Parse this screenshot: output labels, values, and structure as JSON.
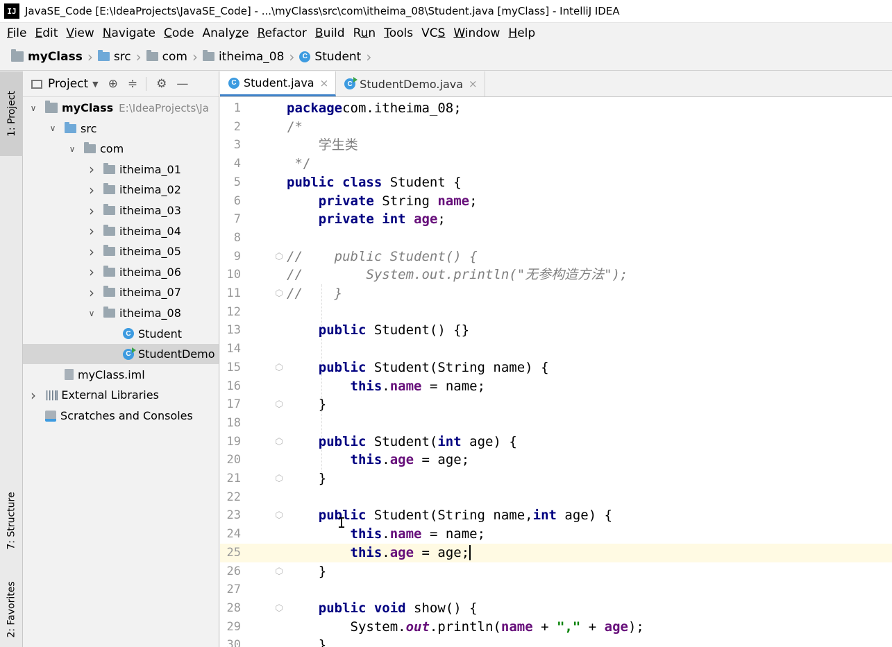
{
  "window": {
    "title": "JavaSE_Code [E:\\IdeaProjects\\JavaSE_Code] - ...\\myClass\\src\\com\\itheima_08\\Student.java [myClass] - IntelliJ IDEA"
  },
  "menu": [
    {
      "underline": "F",
      "rest": "ile"
    },
    {
      "underline": "E",
      "rest": "dit"
    },
    {
      "underline": "V",
      "rest": "iew"
    },
    {
      "underline": "N",
      "rest": "avigate"
    },
    {
      "underline": "C",
      "rest": "ode"
    },
    {
      "pre": "Analy",
      "underline": "z",
      "rest": "e"
    },
    {
      "underline": "R",
      "rest": "efactor"
    },
    {
      "underline": "B",
      "rest": "uild"
    },
    {
      "pre": "R",
      "underline": "u",
      "rest": "n"
    },
    {
      "underline": "T",
      "rest": "ools"
    },
    {
      "pre": "VC",
      "underline": "S",
      "rest": ""
    },
    {
      "underline": "W",
      "rest": "indow"
    },
    {
      "underline": "H",
      "rest": "elp"
    }
  ],
  "breadcrumb": [
    {
      "label": "myClass",
      "icon": "project-folder-icon",
      "bold": true
    },
    {
      "label": "src",
      "icon": "source-folder-icon"
    },
    {
      "label": "com",
      "icon": "package-icon"
    },
    {
      "label": "itheima_08",
      "icon": "package-icon"
    },
    {
      "label": "Student",
      "icon": "class-icon"
    }
  ],
  "sidebar": {
    "tabs": [
      {
        "label": "1: Project",
        "active": true
      },
      {
        "label": "7: Structure"
      },
      {
        "label": "2: Favorites"
      }
    ]
  },
  "project_panel": {
    "header": "Project",
    "tree": [
      {
        "label": "myClass",
        "hint": "E:\\IdeaProjects\\Ja",
        "icon": "project-folder-icon",
        "arrow": "v",
        "bold": true
      },
      {
        "label": "src",
        "icon": "source-folder-icon",
        "arrow": "v"
      },
      {
        "label": "com",
        "icon": "package-icon",
        "arrow": "v"
      },
      {
        "label": "itheima_01",
        "icon": "package-icon",
        "arrow": ">"
      },
      {
        "label": "itheima_02",
        "icon": "package-icon",
        "arrow": ">"
      },
      {
        "label": "itheima_03",
        "icon": "package-icon",
        "arrow": ">"
      },
      {
        "label": "itheima_04",
        "icon": "package-icon",
        "arrow": ">"
      },
      {
        "label": "itheima_05",
        "icon": "package-icon",
        "arrow": ">"
      },
      {
        "label": "itheima_06",
        "icon": "package-icon",
        "arrow": ">"
      },
      {
        "label": "itheima_07",
        "icon": "package-icon",
        "arrow": ">"
      },
      {
        "label": "itheima_08",
        "icon": "package-icon",
        "arrow": "v"
      },
      {
        "label": "Student",
        "icon": "class-icon",
        "arrow": ""
      },
      {
        "label": "StudentDemo",
        "icon": "runnable-class-icon",
        "arrow": "",
        "selected": true
      },
      {
        "label": "myClass.iml",
        "icon": "iml-file-icon",
        "arrow": ""
      },
      {
        "label": "External Libraries",
        "icon": "libraries-icon",
        "arrow": ">"
      },
      {
        "label": "Scratches and Consoles",
        "icon": "scratches-icon",
        "arrow": ""
      }
    ]
  },
  "editor": {
    "tabs": [
      {
        "label": "Student.java",
        "active": true,
        "icon": "class-icon"
      },
      {
        "label": "StudentDemo.java",
        "active": false,
        "icon": "runnable-class-icon"
      }
    ],
    "close_glyph": "×",
    "current_line": 25,
    "lines": [
      {
        "n": "1",
        "s": [
          [
            "kw",
            "package"
          ],
          [
            "",
            "com.itheima_08;"
          ]
        ]
      },
      {
        "n": "2",
        "s": [
          [
            "dcmt",
            "/*"
          ]
        ]
      },
      {
        "n": "3",
        "s": [
          [
            "dcmt",
            "    学生类"
          ]
        ]
      },
      {
        "n": "4",
        "s": [
          [
            "dcmt",
            " */"
          ]
        ]
      },
      {
        "n": "5",
        "s": [
          [
            "kw",
            "public class"
          ],
          [
            "",
            " Student {"
          ]
        ]
      },
      {
        "n": "6",
        "s": [
          [
            "",
            "    "
          ],
          [
            "kw",
            "private"
          ],
          [
            "",
            " String "
          ],
          [
            "fld",
            "name"
          ],
          [
            "",
            ";"
          ]
        ]
      },
      {
        "n": "7",
        "s": [
          [
            "",
            "    "
          ],
          [
            "kw",
            "private int"
          ],
          [
            "",
            " "
          ],
          [
            "fld",
            "age"
          ],
          [
            "",
            ";"
          ]
        ]
      },
      {
        "n": "8",
        "s": []
      },
      {
        "n": "9",
        "s": [
          [
            "cmt",
            "//    public Student() {"
          ]
        ],
        "fold": true
      },
      {
        "n": "10",
        "s": [
          [
            "cmt",
            "//        System.out.println(\"无参构造方法\");"
          ]
        ]
      },
      {
        "n": "11",
        "s": [
          [
            "cmt",
            "//    }"
          ]
        ],
        "fold": true
      },
      {
        "n": "12",
        "s": []
      },
      {
        "n": "13",
        "s": [
          [
            "",
            "    "
          ],
          [
            "kw",
            "public"
          ],
          [
            "",
            " Student() {}"
          ]
        ]
      },
      {
        "n": "14",
        "s": []
      },
      {
        "n": "15",
        "s": [
          [
            "",
            "    "
          ],
          [
            "kw",
            "public"
          ],
          [
            "",
            " Student(String name) {"
          ]
        ],
        "fold": true
      },
      {
        "n": "16",
        "s": [
          [
            "",
            "        "
          ],
          [
            "kw",
            "this"
          ],
          [
            "",
            "."
          ],
          [
            "fld",
            "name"
          ],
          [
            "",
            " = name;"
          ]
        ]
      },
      {
        "n": "17",
        "s": [
          [
            "",
            "    }"
          ]
        ],
        "fold": true
      },
      {
        "n": "18",
        "s": []
      },
      {
        "n": "19",
        "s": [
          [
            "",
            "    "
          ],
          [
            "kw",
            "public"
          ],
          [
            "",
            " Student("
          ],
          [
            "kw",
            "int"
          ],
          [
            "",
            " age) {"
          ]
        ],
        "fold": true
      },
      {
        "n": "20",
        "s": [
          [
            "",
            "        "
          ],
          [
            "kw",
            "this"
          ],
          [
            "",
            "."
          ],
          [
            "fld",
            "age"
          ],
          [
            "",
            " = age;"
          ]
        ]
      },
      {
        "n": "21",
        "s": [
          [
            "",
            "    }"
          ]
        ],
        "fold": true
      },
      {
        "n": "22",
        "s": []
      },
      {
        "n": "23",
        "s": [
          [
            "",
            "    "
          ],
          [
            "kw",
            "public"
          ],
          [
            "",
            " Student(String name,"
          ],
          [
            "kw",
            "int"
          ],
          [
            "",
            " age) {"
          ]
        ],
        "fold": true
      },
      {
        "n": "24",
        "s": [
          [
            "",
            "        "
          ],
          [
            "kw",
            "this"
          ],
          [
            "",
            "."
          ],
          [
            "fld",
            "name"
          ],
          [
            "",
            " = name;"
          ]
        ]
      },
      {
        "n": "25",
        "s": [
          [
            "",
            "        "
          ],
          [
            "kw",
            "this"
          ],
          [
            "",
            "."
          ],
          [
            "fld",
            "age"
          ],
          [
            "",
            " = age;"
          ]
        ],
        "caret": true
      },
      {
        "n": "26",
        "s": [
          [
            "",
            "    }"
          ]
        ],
        "fold": true
      },
      {
        "n": "27",
        "s": []
      },
      {
        "n": "28",
        "s": [
          [
            "",
            "    "
          ],
          [
            "kw",
            "public void"
          ],
          [
            "",
            " show() {"
          ]
        ],
        "fold": true
      },
      {
        "n": "29",
        "s": [
          [
            "",
            "        System."
          ],
          [
            "stat",
            "out"
          ],
          [
            "",
            ".println("
          ],
          [
            "fld",
            "name"
          ],
          [
            "",
            " + "
          ],
          [
            "str",
            "\",\""
          ],
          [
            "",
            " + "
          ],
          [
            "fld",
            "age"
          ],
          [
            "",
            ");"
          ]
        ]
      },
      {
        "n": "30",
        "s": [
          [
            "",
            "    }"
          ]
        ]
      }
    ]
  }
}
